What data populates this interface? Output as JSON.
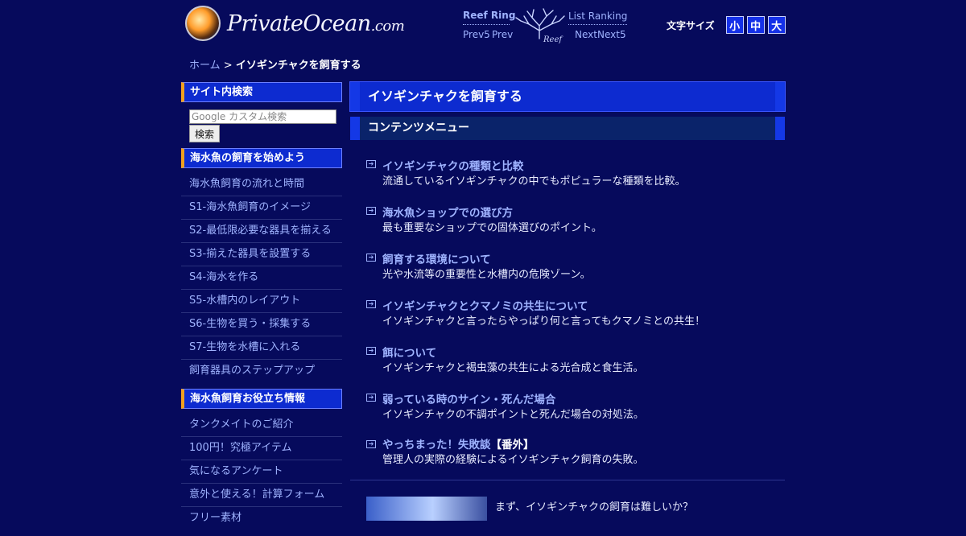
{
  "header": {
    "logo_text": "PrivateOcean",
    "logo_suffix": ".com",
    "ring": {
      "title": "Reef Ring",
      "list": "List Ranking",
      "prev5": "Prev5",
      "prev": "Prev",
      "next": "Next",
      "next5": "Next5"
    },
    "fontsize": {
      "label": "文字サイズ",
      "small": "小",
      "medium": "中",
      "large": "大"
    }
  },
  "breadcrumb": {
    "home": "ホーム",
    "separator": ">",
    "current": "イソギンチャクを飼育する"
  },
  "sidebar": {
    "search_heading": "サイト内検索",
    "search_placeholder": "Google カスタム検索",
    "search_button": "検索",
    "section1": {
      "heading": "海水魚の飼育を始めよう",
      "items": [
        "海水魚飼育の流れと時間",
        "S1-海水魚飼育のイメージ",
        "S2-最低限必要な器具を揃える",
        "S3-揃えた器具を設置する",
        "S4-海水を作る",
        "S5-水槽内のレイアウト",
        "S6-生物を買う・採集する",
        "S7-生物を水槽に入れる",
        "飼育器具のステップアップ"
      ]
    },
    "section2": {
      "heading": "海水魚飼育お役立ち情報",
      "items": [
        "タンクメイトのご紹介",
        "100円！究極アイテム",
        "気になるアンケート",
        "意外と使える！計算フォーム",
        "フリー素材"
      ]
    }
  },
  "main": {
    "title": "イソギンチャクを飼育する",
    "menu_title": "コンテンツメニュー",
    "items": [
      {
        "title": "イソギンチャクの種類と比較",
        "extra": "",
        "desc": "流通しているイソギンチャクの中でもポピュラーな種類を比較。"
      },
      {
        "title": "海水魚ショップでの選び方",
        "extra": "",
        "desc": "最も重要なショップでの固体選びのポイント。"
      },
      {
        "title": "飼育する環境について",
        "extra": "",
        "desc": "光や水流等の重要性と水槽内の危険ゾーン。"
      },
      {
        "title": "イソギンチャクとクマノミの共生について",
        "extra": "",
        "desc": "イソギンチャクと言ったらやっぱり何と言ってもクマノミとの共生！"
      },
      {
        "title": "餌について",
        "extra": "",
        "desc": "イソギンチャクと褐虫藻の共生による光合成と食生活。"
      },
      {
        "title": "弱っている時のサイン・死んだ場合",
        "extra": "",
        "desc": "イソギンチャクの不調ポイントと死んだ場合の対処法。"
      },
      {
        "title": "やっちまった！失敗談",
        "extra": "【番外】",
        "desc": "管理人の実際の経験によるイソギンチャク飼育の失敗。"
      }
    ],
    "teaser_text": "まず、イソギンチャクの飼育は難しいか？"
  }
}
